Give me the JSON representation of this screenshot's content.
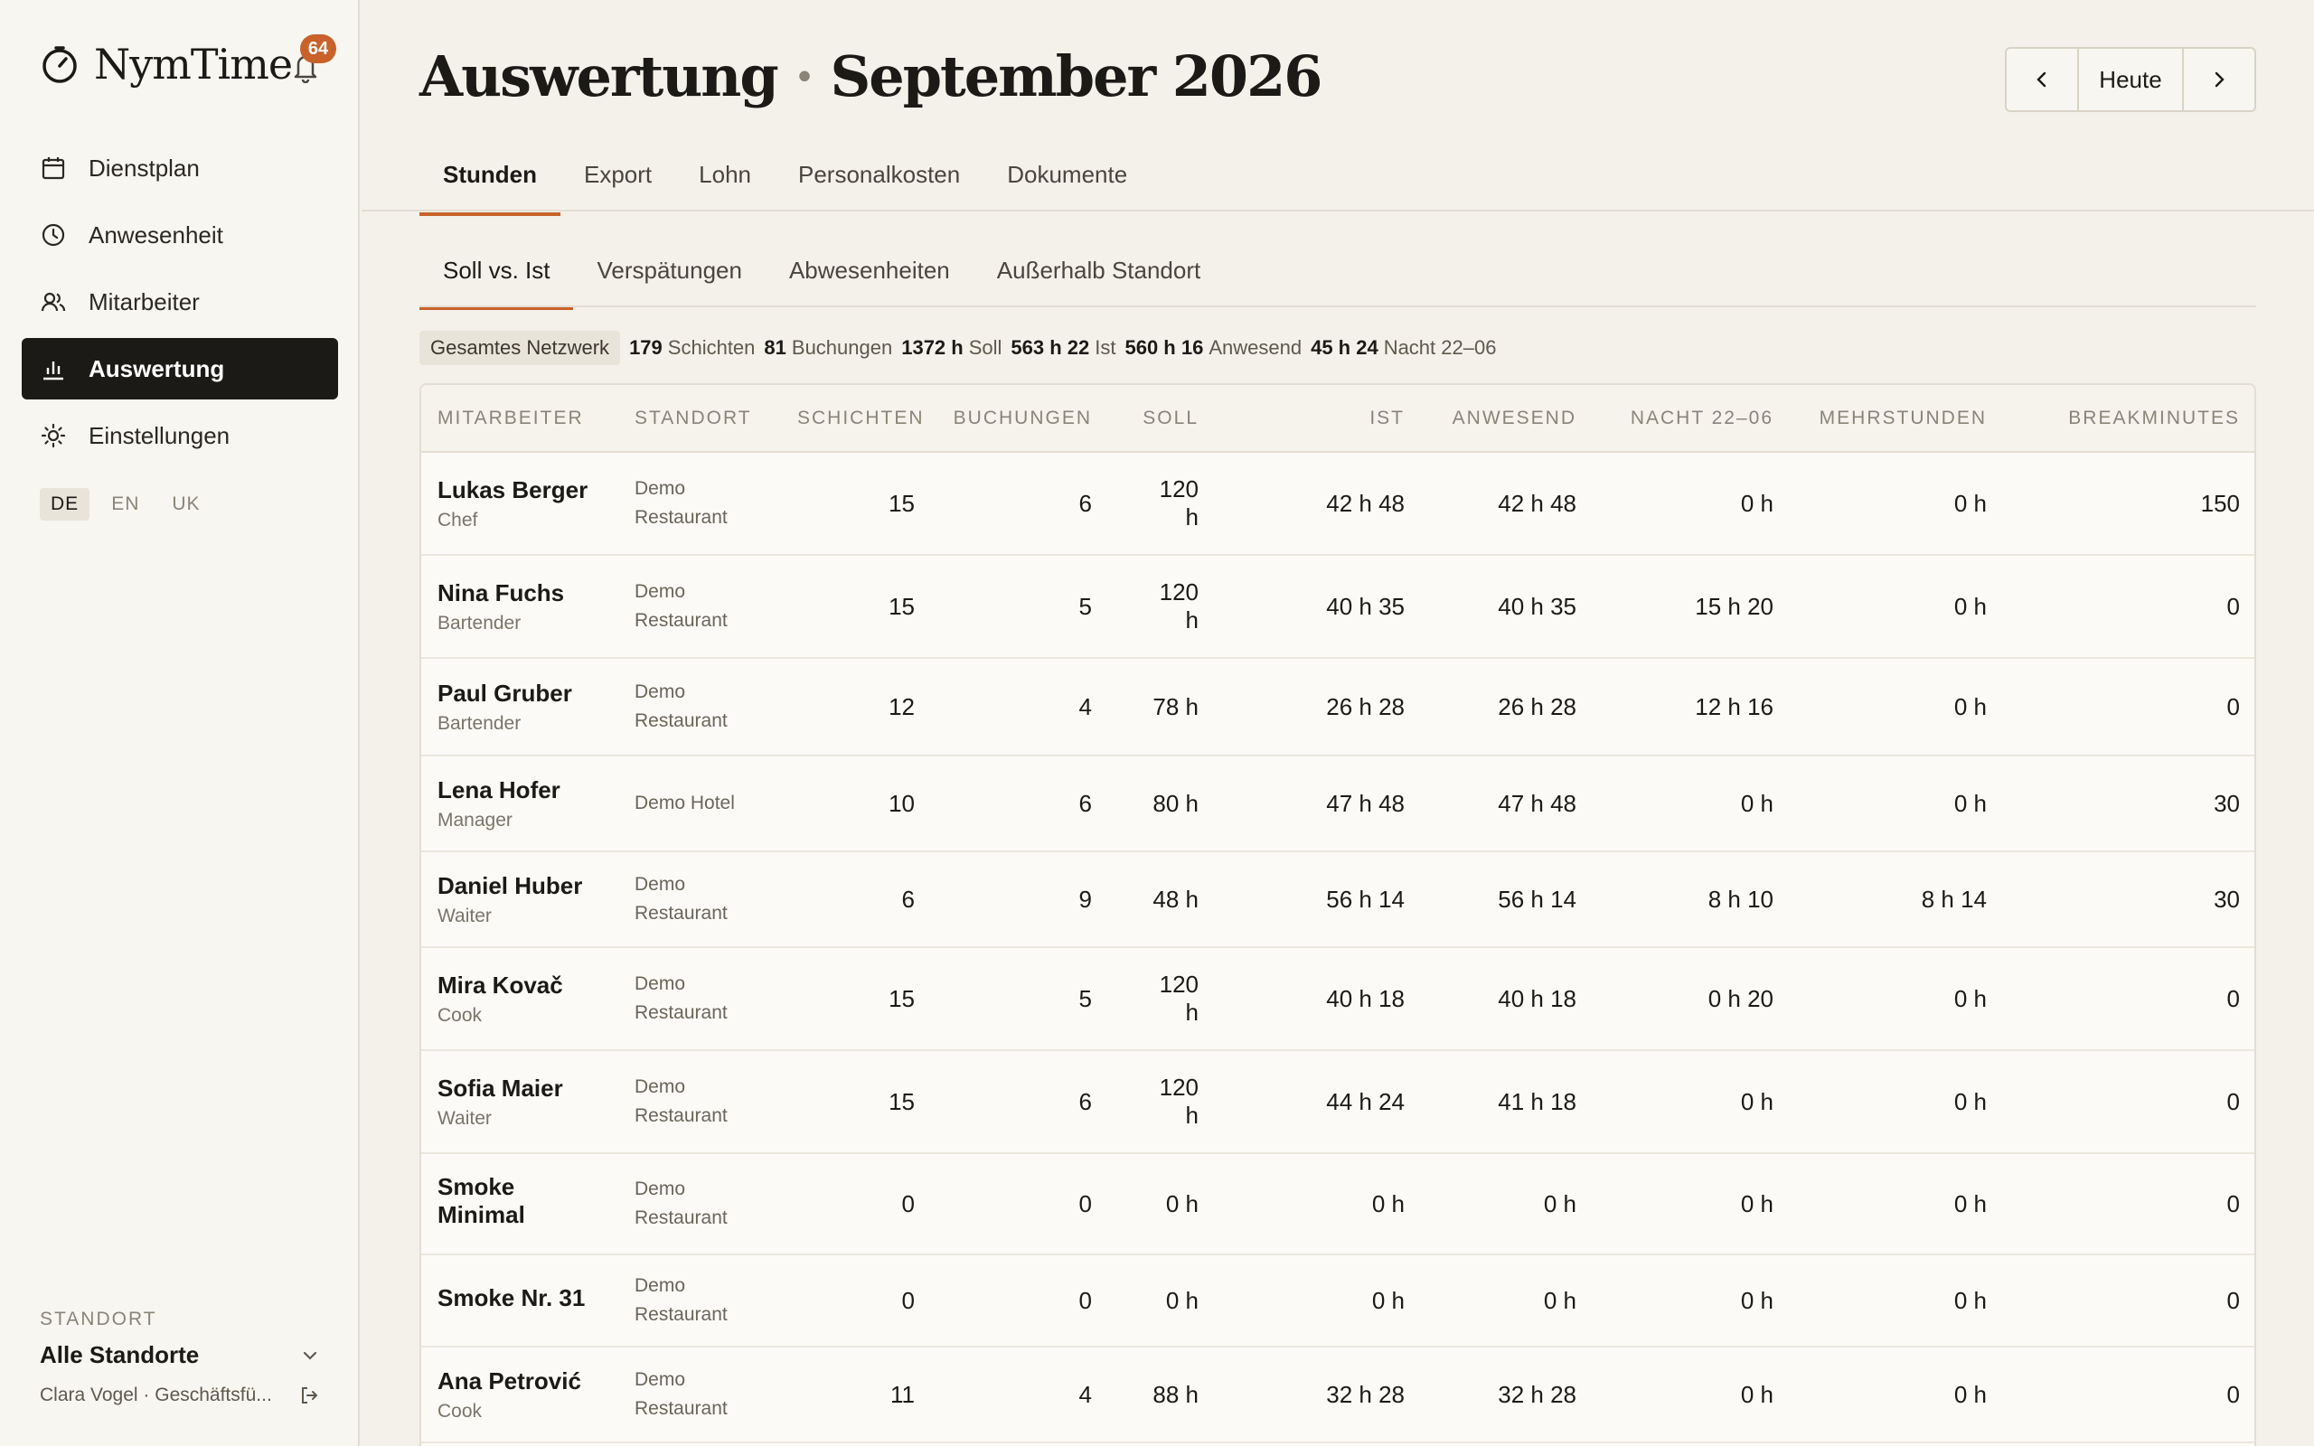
{
  "app": {
    "name": "NymTime",
    "notification_count": "64"
  },
  "sidebar": {
    "items": [
      {
        "label": "Dienstplan",
        "icon": "calendar-icon"
      },
      {
        "label": "Anwesenheit",
        "icon": "clock-icon"
      },
      {
        "label": "Mitarbeiter",
        "icon": "users-icon"
      },
      {
        "label": "Auswertung",
        "icon": "bar-chart-icon"
      },
      {
        "label": "Einstellungen",
        "icon": "gear-icon"
      }
    ],
    "languages": [
      "DE",
      "EN",
      "UK"
    ],
    "standort_label": "STANDORT",
    "standort_value": "Alle Standorte",
    "user": "Clara Vogel · Geschäftsfü..."
  },
  "header": {
    "title": "Auswertung",
    "title_sep": " · ",
    "period": "September 2026",
    "today_label": "Heute"
  },
  "tabs": [
    "Stunden",
    "Export",
    "Lohn",
    "Personalkosten",
    "Dokumente"
  ],
  "subtabs": [
    "Soll vs. Ist",
    "Verspätungen",
    "Abwesenheiten",
    "Außerhalb Standort"
  ],
  "summary": {
    "scope": "Gesamtes Netzwerk",
    "schichten_value": "179",
    "schichten_label": "Schichten",
    "buchungen_value": "81",
    "buchungen_label": "Buchungen",
    "soll_value": "1372 h",
    "soll_label": "Soll",
    "ist_value": "563 h 22",
    "ist_label": "Ist",
    "anwesend_value": "560 h 16",
    "anwesend_label": "Anwesend",
    "nacht_value": "45 h 24",
    "nacht_label": "Nacht 22–06"
  },
  "table": {
    "columns": [
      "Mitarbeiter",
      "Standort",
      "Schichten",
      "Buchungen",
      "Soll",
      "Ist",
      "Anwesend",
      "Nacht 22–06",
      "Mehrstunden",
      "Breakminutes"
    ],
    "rows": [
      {
        "name": "Lukas Berger",
        "role": "Chef",
        "loc1": "Demo",
        "loc2": "Restaurant",
        "schichten": "15",
        "buchungen": "6",
        "soll1": "120",
        "soll2": "h",
        "ist": "42 h 48",
        "anwesend": "42 h 48",
        "nacht": "0 h",
        "mehr": "0 h",
        "breaks": "150"
      },
      {
        "name": "Nina Fuchs",
        "role": "Bartender",
        "loc1": "Demo",
        "loc2": "Restaurant",
        "schichten": "15",
        "buchungen": "5",
        "soll1": "120",
        "soll2": "h",
        "ist": "40 h 35",
        "anwesend": "40 h 35",
        "nacht": "15 h 20",
        "mehr": "0 h",
        "breaks": "0"
      },
      {
        "name": "Paul Gruber",
        "role": "Bartender",
        "loc1": "Demo",
        "loc2": "Restaurant",
        "schichten": "12",
        "buchungen": "4",
        "soll1": "78 h",
        "soll2": "",
        "ist": "26 h 28",
        "anwesend": "26 h 28",
        "nacht": "12 h 16",
        "mehr": "0 h",
        "breaks": "0"
      },
      {
        "name": "Lena Hofer",
        "role": "Manager",
        "loc1": "Demo Hotel",
        "loc2": "",
        "schichten": "10",
        "buchungen": "6",
        "soll1": "80 h",
        "soll2": "",
        "ist": "47 h 48",
        "anwesend": "47 h 48",
        "nacht": "0 h",
        "mehr": "0 h",
        "breaks": "30"
      },
      {
        "name": "Daniel Huber",
        "role": "Waiter",
        "loc1": "Demo",
        "loc2": "Restaurant",
        "schichten": "6",
        "buchungen": "9",
        "soll1": "48 h",
        "soll2": "",
        "ist": "56 h 14",
        "anwesend": "56 h 14",
        "nacht": "8 h 10",
        "mehr": "8 h 14",
        "breaks": "30"
      },
      {
        "name": "Mira Kovač",
        "role": "Cook",
        "loc1": "Demo",
        "loc2": "Restaurant",
        "schichten": "15",
        "buchungen": "5",
        "soll1": "120",
        "soll2": "h",
        "ist": "40 h 18",
        "anwesend": "40 h 18",
        "nacht": "0 h 20",
        "mehr": "0 h",
        "breaks": "0"
      },
      {
        "name": "Sofia Maier",
        "role": "Waiter",
        "loc1": "Demo",
        "loc2": "Restaurant",
        "schichten": "15",
        "buchungen": "6",
        "soll1": "120",
        "soll2": "h",
        "ist": "44 h 24",
        "anwesend": "41 h 18",
        "nacht": "0 h",
        "mehr": "0 h",
        "breaks": "0"
      },
      {
        "name": "Smoke Minimal",
        "role": "",
        "loc1": "Demo",
        "loc2": "Restaurant",
        "schichten": "0",
        "buchungen": "0",
        "soll1": "0 h",
        "soll2": "",
        "ist": "0 h",
        "anwesend": "0 h",
        "nacht": "0 h",
        "mehr": "0 h",
        "breaks": "0"
      },
      {
        "name": "Smoke Nr. 31",
        "role": "",
        "loc1": "Demo",
        "loc2": "Restaurant",
        "schichten": "0",
        "buchungen": "0",
        "soll1": "0 h",
        "soll2": "",
        "ist": "0 h",
        "anwesend": "0 h",
        "nacht": "0 h",
        "mehr": "0 h",
        "breaks": "0"
      },
      {
        "name": "Ana Petrović",
        "role": "Cook",
        "loc1": "Demo",
        "loc2": "Restaurant",
        "schichten": "11",
        "buchungen": "4",
        "soll1": "88 h",
        "soll2": "",
        "ist": "32 h 28",
        "anwesend": "32 h 28",
        "nacht": "0 h",
        "mehr": "0 h",
        "breaks": "0"
      }
    ]
  },
  "colors": {
    "accent": "#c8622a",
    "background": "#f4f1ea",
    "active_nav": "#1c1a17"
  }
}
